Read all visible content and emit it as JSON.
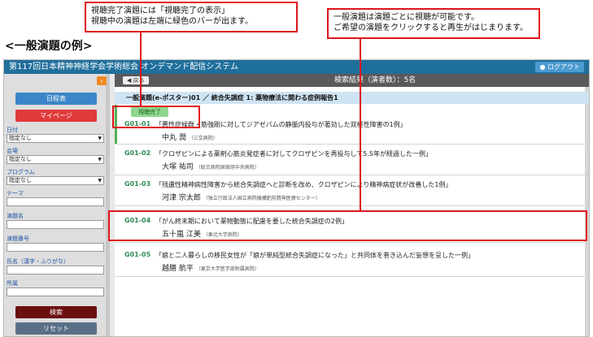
{
  "annotations": {
    "left_callout": [
      "視聴完了演題には「視聴完了の表示」",
      "視聴中の演題は左端に緑色のバーが出ます。"
    ],
    "right_callout": [
      "一般演題は演題ごとに視聴が可能です。",
      "ご希望の演題をクリックすると再生がはじまります。"
    ],
    "section_heading": "<一般演題の例>"
  },
  "app": {
    "title": "第117回日本精神神経学会学術総会 オンデマンド配信システム",
    "logout_label": "ログアウト"
  },
  "sidebar": {
    "collapse_label": "‹",
    "schedule_label": "日程表",
    "mypage_label": "マイページ",
    "filters": [
      {
        "label": "日付",
        "value": "指定なし",
        "select": true
      },
      {
        "label": "会場",
        "value": "指定なし",
        "select": true
      },
      {
        "label": "プログラム",
        "value": "指定なし",
        "select": true
      },
      {
        "label": "テーマ",
        "value": "",
        "select": false
      },
      {
        "label": "演題名",
        "value": "",
        "select": false
      },
      {
        "label": "演題番号",
        "value": "",
        "select": false
      },
      {
        "label": "氏名（漢字・ふりがな）",
        "value": "",
        "select": false
      },
      {
        "label": "所属",
        "value": "",
        "select": false
      }
    ],
    "search_label": "検索",
    "reset_label": "リセット"
  },
  "main": {
    "back_label": "戻る",
    "result_count": "検索結果（演者数）：5名",
    "session_header": "一般演題(e-ポスター)01 ／ 統合失調症 1: 薬物療法に関わる症例報告1",
    "status_badge": "視聴完了",
    "items": [
      {
        "code": "G01-01",
        "title": "「悪性症候群・筋強剛に対してジアゼパムの静脈内投与が著効した双極性障害の1例」",
        "author": "中丸 潤",
        "affiliation": "（三交病院）"
      },
      {
        "code": "G01-02",
        "title": "「クロザピンによる薬剤心筋炎発症者に対してクロザピンを再投与して5.5年が経過した一例」",
        "author": "大塚 祐司",
        "affiliation": "（総合病院国保旭中央病院）"
      },
      {
        "code": "G01-03",
        "title": "「残遺性精神病性障害から統合失調症へと診断を改め、クロザピンにより精神病症状が改善した1例」",
        "author": "河津 宗太郎",
        "affiliation": "（独立行政法人国立病院機構肥前精神医療センター）"
      },
      {
        "code": "G01-04",
        "title": "「がん終末期において薬物動態に配慮を要した統合失調症の2例」",
        "author": "五十嵐 江美",
        "affiliation": "（東北大学病院）"
      },
      {
        "code": "G01-05",
        "title": "「娘と二人暮らしの移民女性が「娘が単純型統合失調症になった」と共同体を巻き込んだ妄想を呈した一例」",
        "author": "越膳 航平",
        "affiliation": "（東京大学医学部附属病院）"
      }
    ]
  }
}
